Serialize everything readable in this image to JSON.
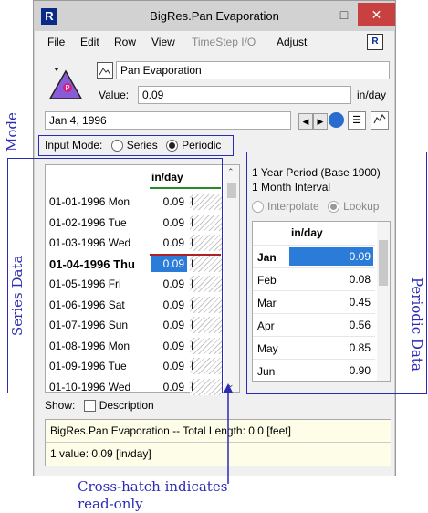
{
  "window": {
    "title": "BigRes.Pan Evaporation"
  },
  "menu": {
    "items": [
      "File",
      "Edit",
      "Row",
      "View",
      "TimeStep I/O",
      "Adjust"
    ]
  },
  "slot": {
    "name": "Pan Evaporation",
    "value_label": "Value:",
    "value": "0.09",
    "units": "in/day",
    "date": "Jan 4, 1996"
  },
  "input_mode": {
    "label": "Input Mode:",
    "series": "Series",
    "periodic": "Periodic",
    "selected": "Periodic"
  },
  "series": {
    "column_header": "in/day",
    "rows": [
      {
        "date": "01-01-1996 Mon",
        "value": "0.09",
        "flag": "I"
      },
      {
        "date": "01-02-1996 Tue",
        "value": "0.09",
        "flag": "I"
      },
      {
        "date": "01-03-1996 Wed",
        "value": "0.09",
        "flag": "I"
      },
      {
        "date": "01-04-1996 Thu",
        "value": "0.09",
        "flag": "I"
      },
      {
        "date": "01-05-1996 Fri",
        "value": "0.09",
        "flag": "I"
      },
      {
        "date": "01-06-1996 Sat",
        "value": "0.09",
        "flag": "I"
      },
      {
        "date": "01-07-1996 Sun",
        "value": "0.09",
        "flag": "I"
      },
      {
        "date": "01-08-1996 Mon",
        "value": "0.09",
        "flag": "I"
      },
      {
        "date": "01-09-1996 Tue",
        "value": "0.09",
        "flag": "I"
      },
      {
        "date": "01-10-1996 Wed",
        "value": "0.09",
        "flag": "I"
      }
    ],
    "current_row": 3
  },
  "periodic": {
    "period": "1 Year Period (Base 1900)",
    "interval": "1 Month Interval",
    "interpolate": "Interpolate",
    "lookup": "Lookup",
    "column_header": "in/day",
    "rows": [
      {
        "month": "Jan",
        "value": "0.09"
      },
      {
        "month": "Feb",
        "value": "0.08"
      },
      {
        "month": "Mar",
        "value": "0.45"
      },
      {
        "month": "Apr",
        "value": "0.56"
      },
      {
        "month": "May",
        "value": "0.85"
      },
      {
        "month": "Jun",
        "value": "0.90"
      }
    ],
    "current_row": 0
  },
  "show": {
    "label": "Show:",
    "description": "Description"
  },
  "info": {
    "line1": "BigRes.Pan Evaporation -- Total Length: 0.0 [feet]",
    "line2": "1 value:  0.09 [in/day]"
  },
  "annotations": {
    "mode": "Mode",
    "series_data": "Series Data",
    "periodic_data": "Periodic Data",
    "crosshatch_1": "Cross-hatch indicates",
    "crosshatch_2": "read-only"
  },
  "colors": {
    "annotation": "#2b2bb5",
    "selection": "#2b7bd8"
  }
}
